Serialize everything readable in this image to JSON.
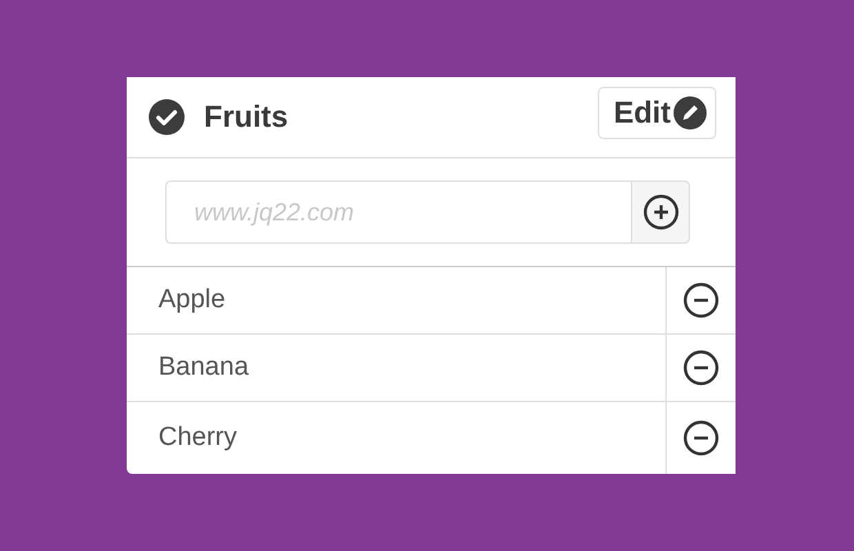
{
  "header": {
    "title": "Fruits",
    "edit_button": "Edit"
  },
  "add_field": {
    "placeholder": "www.jq22.com"
  },
  "items": [
    {
      "label": "Apple"
    },
    {
      "label": "Banana"
    },
    {
      "label": "Cherry"
    }
  ]
}
